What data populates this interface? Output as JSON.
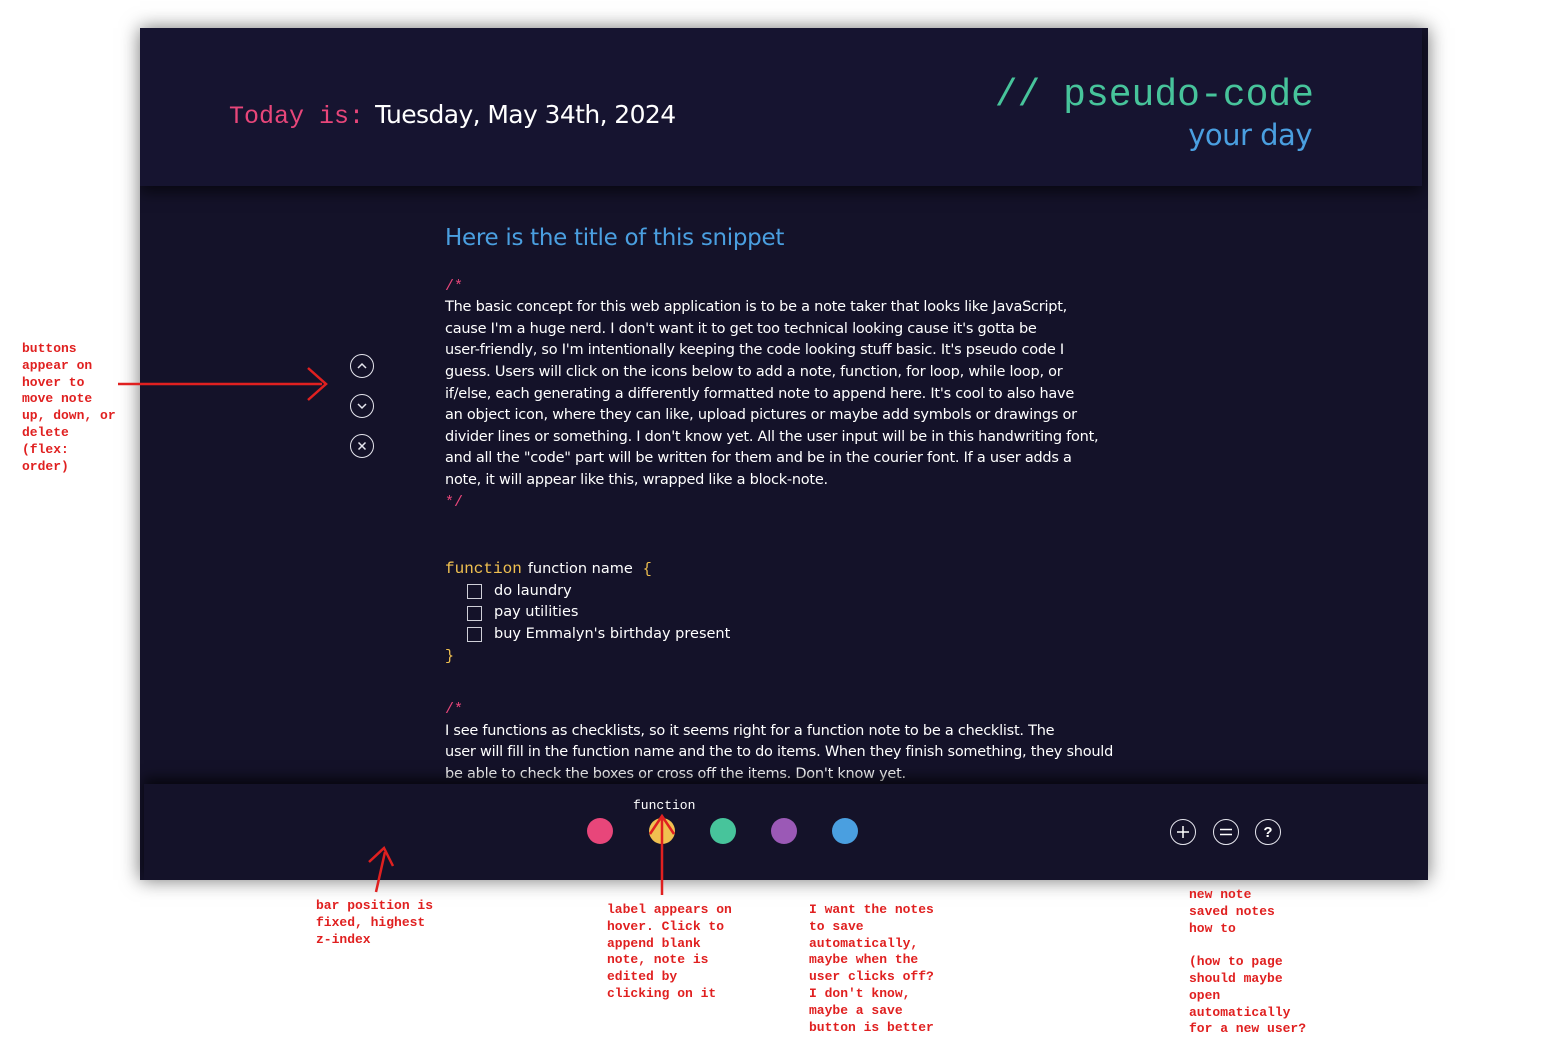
{
  "header": {
    "today_label": "Today is:",
    "today_date": "Tuesday, May 34th, 2024",
    "logo_line1": "// pseudo-code",
    "logo_line2": "your day"
  },
  "snippet": {
    "title": "Here is the title of this snippet",
    "comment_open": "/*",
    "comment_close": "*/",
    "lines": [
      "The basic concept for this web application is to be a note taker that looks like JavaScript,",
      "cause I'm a huge nerd.  I don't want it to get too technical looking cause it's gotta be",
      "user-friendly, so I'm intentionally keeping the code looking stuff basic.  It's pseudo code I",
      "guess. Users will click on the icons below to add a note, function, for loop, while loop, or",
      "if/else, each generating a differently formatted note to append here. It's cool to also have",
      "an object icon, where they can like, upload pictures or maybe add symbols or drawings or",
      "divider lines or something. I don't know yet. All the user input will be in this handwriting font,",
      "and all the \"code\" part will be written for them and be in the courier font. If a user adds a",
      "note, it will appear like this, wrapped like a block-note."
    ]
  },
  "function_note": {
    "keyword": "function",
    "name": "function name",
    "open_brace": "{",
    "close_brace": "}",
    "items": [
      "do laundry",
      "pay utilities",
      "buy Emmalyn's birthday present"
    ]
  },
  "second_note": {
    "comment_open": "/*",
    "lines": [
      "I see functions as checklists, so it seems right for a function note to be a checklist. The",
      "user will fill in the function name and the to do items. When they finish something, they should",
      "be able to check the boxes or cross off the items. Don't know yet."
    ]
  },
  "side_buttons": {
    "up_icon": "chevron-up-icon",
    "down_icon": "chevron-down-icon",
    "delete_icon": "close-icon"
  },
  "toolbar": {
    "hover_label": "function",
    "dots": [
      {
        "name": "note-dot",
        "color": "#e8467a"
      },
      {
        "name": "function-dot",
        "color": "#f0c050"
      },
      {
        "name": "for-loop-dot",
        "color": "#47c49b"
      },
      {
        "name": "while-loop-dot",
        "color": "#9b59b6"
      },
      {
        "name": "if-else-dot",
        "color": "#4a9fe0"
      }
    ],
    "new_note_icon": "plus-icon",
    "saved_notes_icon": "equals-icon",
    "help_glyph": "?"
  },
  "annotations": {
    "buttons_hover": [
      "buttons",
      "appear on",
      "hover to",
      "move note",
      "up, down, or",
      "delete",
      "(flex:",
      "order)"
    ],
    "bar_position": [
      "bar position is",
      "fixed, highest",
      "z-index"
    ],
    "label_hover": [
      "label appears on",
      "hover. Click to",
      "append blank",
      "note, note is",
      "edited by",
      "clicking on it"
    ],
    "autosave": [
      "I want the notes",
      "to save",
      "automatically,",
      "maybe when the",
      "user clicks off?",
      "I don't know,",
      "maybe a save",
      "button is better"
    ],
    "right_buttons": [
      "new note",
      "saved notes",
      "how to",
      "",
      "(how to page",
      "should maybe",
      "open",
      "automatically",
      "for a new user?"
    ]
  },
  "colors": {
    "background": "#141229",
    "pink": "#e8467a",
    "yellow": "#f0c050",
    "green": "#47c49b",
    "purple": "#9b59b6",
    "blue": "#4a9fe0",
    "annotation_red": "#e02020"
  }
}
